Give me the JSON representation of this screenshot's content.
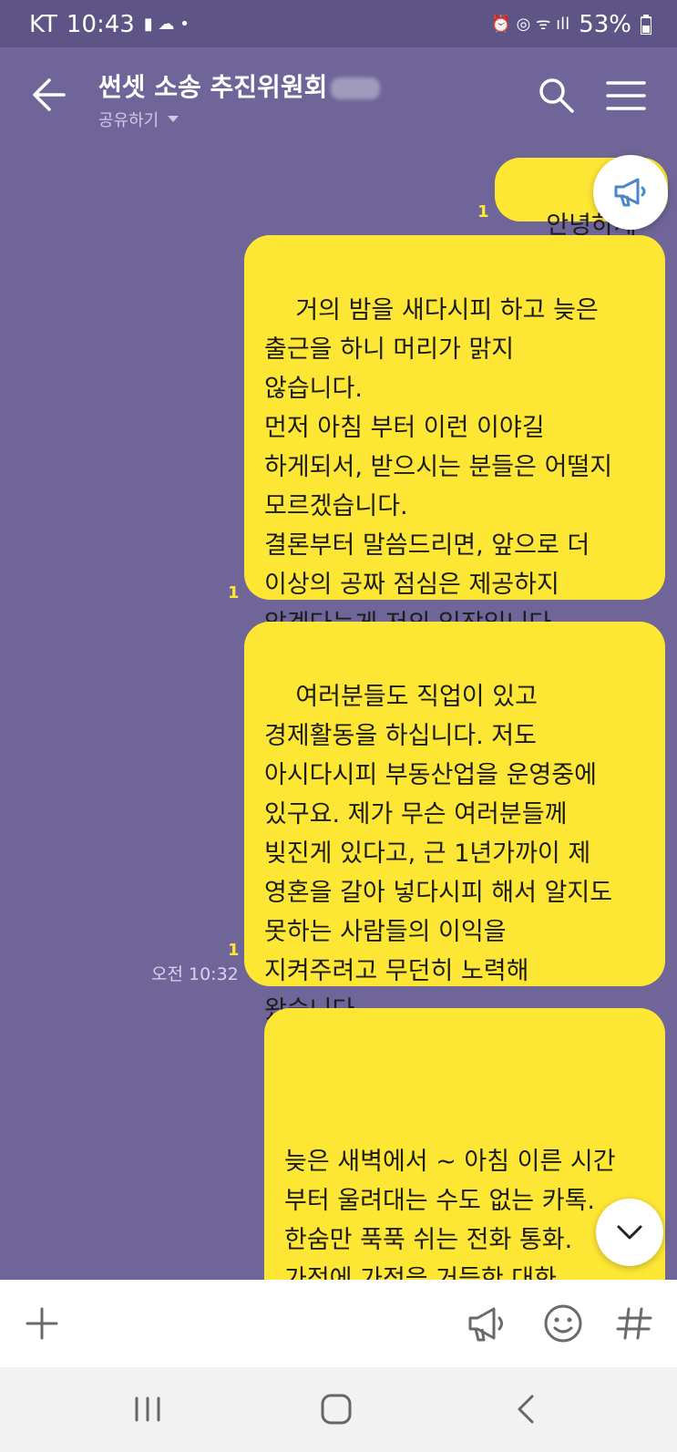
{
  "status": {
    "carrier": "KT",
    "time": "10:43",
    "battery": "53%"
  },
  "header": {
    "title": "썬셋 소송 추진위원회",
    "share_label": "공유하기"
  },
  "messages": [
    {
      "text": "안녕하세",
      "unread": "1"
    },
    {
      "text": "거의 밤을 새다시피 하고 늦은\n출근을 하니 머리가 맑지\n않습니다.\n먼저 아침 부터 이런 이야길\n하게되서, 받으시는 분들은 어떨지\n모르겠습니다.\n결론부터 말씀드리면, 앞으로 더\n이상의 공짜 점심은 제공하지\n않겠다는게 저의 입장입니다.",
      "unread": "1"
    },
    {
      "text": "여러분들도 직업이 있고\n경제활동을 하십니다. 저도\n아시다시피 부동산업을 운영중에\n있구요. 제가 무슨 여러분들께\n빚진게 있다고, 근 1년가까이 제\n영혼을 갈아 넣다시피 해서 알지도\n못하는 사람들의 이익을\n지켜주려고 무던히 노력해\n왔습니다.",
      "unread": "1",
      "time": "오전 10:32"
    },
    {
      "text": "\n\n늦은 새벽에서 ~ 아침 이른 시간\n부터 울려대는 수도 없는 카톡.\n한숨만 푹푹 쉬는 전화 통화.\n가정에 가정을 거듭한 대화.\n뭔가를 들쳐내고자, 너는 어떻게"
    }
  ],
  "icons": {
    "back": "back-arrow-icon",
    "search": "search-icon",
    "menu": "menu-icon",
    "notice": "megaphone-icon",
    "scroll_down": "chevron-down-icon",
    "add": "plus-icon",
    "emoji": "emoji-icon",
    "hashtag": "hashtag-icon"
  },
  "colors": {
    "background": "#6f6598",
    "bubble": "#fee734",
    "unread": "#fee734"
  }
}
